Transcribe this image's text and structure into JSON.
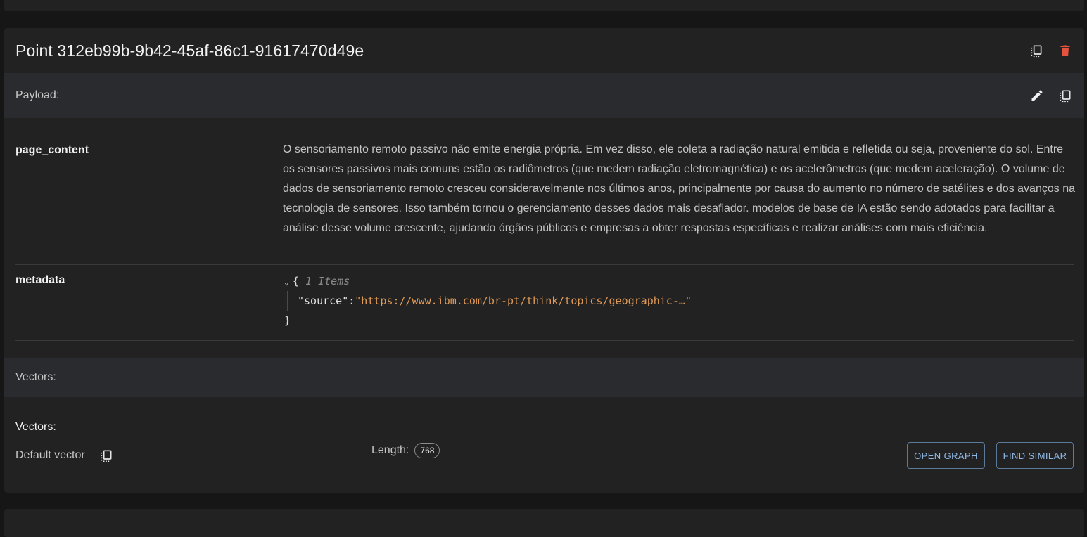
{
  "point": {
    "title": "Point 312eb99b-9b42-45af-86c1-91617470d49e"
  },
  "payload": {
    "label": "Payload:",
    "fields": [
      {
        "key": "page_content",
        "value": "O sensoriamento remoto passivo não emite energia própria. Em vez disso, ele coleta a radiação natural emitida e refletida ou seja, proveniente do sol. Entre os sensores passivos mais comuns estão os radiômetros (que medem radiação eletromagnética) e os acelerômetros (que medem aceleração). O volume de dados de sensoriamento remoto cresceu consideravelmente nos últimos anos, principalmente por causa do aumento no número de satélites e dos avanços na tecnologia de sensores. Isso também tornou o gerenciamento desses dados mais desafiador. modelos de base de IA estão sendo adotados para facilitar a análise desse volume crescente, ajudando órgãos públicos e empresas a obter respostas específicas e realizar análises com mais eficiência."
      },
      {
        "key": "metadata",
        "json": {
          "open_brace": "{",
          "items_count": "1 Items",
          "entry_key": "\"source\"",
          "colon": ":",
          "entry_value": "\"https://www.ibm.com/br-pt/think/topics/geographic-…\"",
          "close_brace": "}"
        }
      }
    ]
  },
  "vectors": {
    "section_label": "Vectors:",
    "title": "Vectors:",
    "default_vector_label": "Default vector",
    "length_label": "Length:",
    "length_value": "768",
    "open_graph_label": "OPEN GRAPH",
    "find_similar_label": "FIND SIMILAR"
  },
  "colors": {
    "background": "#161616",
    "card": "#222222",
    "section_bar": "#2a2b2f",
    "delete_icon": "#e5533f",
    "json_string": "#e09a57",
    "button_text": "#8fb8e6"
  },
  "icons": {
    "header_copy": "copy-icon",
    "header_delete": "trash-icon",
    "payload_edit": "pencil-icon",
    "payload_copy": "copy-icon",
    "vector_copy": "copy-icon"
  }
}
